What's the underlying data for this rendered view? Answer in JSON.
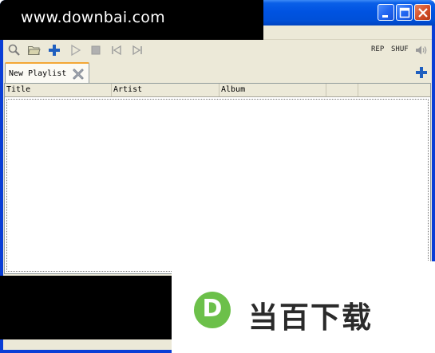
{
  "watermark": {
    "text": "www.downbai.com"
  },
  "window_controls": {
    "minimize": "minimize-icon",
    "maximize": "maximize-icon",
    "close": "close-icon"
  },
  "toolbar": {
    "icons": [
      "search-icon",
      "folder-open-icon",
      "add-icon",
      "play-icon",
      "stop-icon",
      "previous-icon",
      "next-icon"
    ],
    "repeat_label": "REP",
    "shuffle_label": "SHUF",
    "volume_icon": "volume-icon"
  },
  "tabs": [
    {
      "label": "New Playlist"
    }
  ],
  "playlist": {
    "columns": [
      "Title",
      "Artist",
      "Album"
    ],
    "rows": []
  },
  "logo": {
    "letter": "D",
    "text": "当百下载",
    "accent": "#6cc04a"
  },
  "colors": {
    "titlebar": "#0053e1",
    "window_bg": "#ece9d8",
    "tab_accent": "#f4a735",
    "add_blue": "#1f5fbf"
  }
}
